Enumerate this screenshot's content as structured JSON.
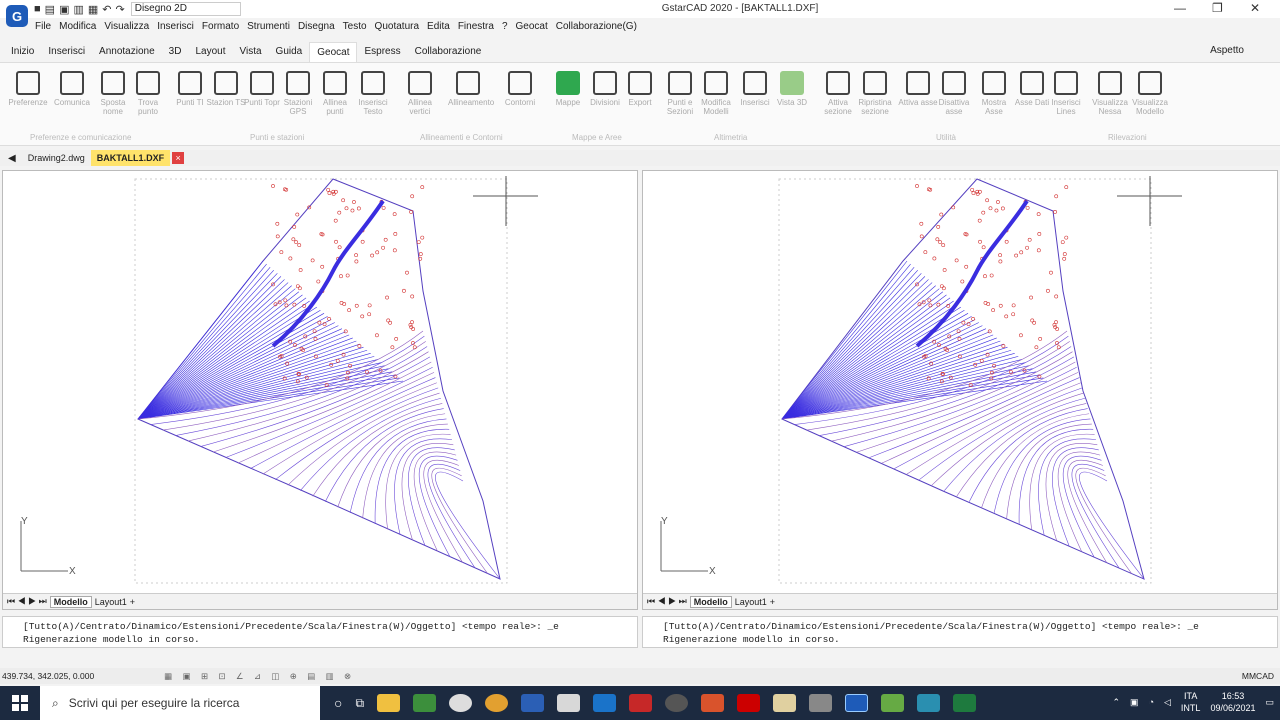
{
  "window": {
    "title": "GstarCAD 2020 - [BAKTALL1.DXF]",
    "workspace": "Disegno 2D",
    "logo": "G"
  },
  "menu": [
    "File",
    "Modifica",
    "Visualizza",
    "Inserisci",
    "Formato",
    "Strumenti",
    "Disegna",
    "Testo",
    "Quotatura",
    "Edita",
    "Finestra",
    "?",
    "Geocat",
    "Collaborazione(G)"
  ],
  "ribbon_tabs": [
    "Inizio",
    "Inserisci",
    "Annotazione",
    "3D",
    "Layout",
    "Vista",
    "Guida",
    "Geocat",
    "Espress",
    "Collaborazione"
  ],
  "active_tab": "Geocat",
  "aspetto": "Aspetto",
  "ribbon_tools": [
    "Preferenze",
    "Comunica",
    "Sposta nome",
    "Trova punto",
    "Punti TI",
    "Stazion TS",
    "Punti Topr",
    "Stazioni GPS",
    "Allinea punti",
    "Inserisci Testo",
    "Allinea vertici",
    "Allineamento",
    "Contorni",
    "Mappe",
    "Divisioni",
    "Export",
    "Punti e Sezioni",
    "Modifica Modelli",
    "Inserisci",
    "Vista 3D",
    "Attiva sezione",
    "Ripristina sezione",
    "Attiva asse",
    "Disattiva asse",
    "Mostra Asse",
    "Asse Dati",
    "Inserisci Lines",
    "Visualizza Nessa",
    "Visualizza Modello"
  ],
  "ribbon_groups": [
    "Preferenze e comunicazione",
    "Punti e stazioni",
    "Allineamenti e Contorni",
    "Mappe e Aree",
    "Altimetria",
    "Utilità",
    "Rilevazioni"
  ],
  "doc_tabs": [
    "Drawing2.dwg",
    "BAKTALL1.DXF"
  ],
  "active_doc": "BAKTALL1.DXF",
  "doc_close": "×",
  "viewport_tabs": {
    "model": "Modello",
    "layout": "Layout1",
    "add": "+",
    "nav": "⏮ ◀ ▶ ⏭"
  },
  "axis": {
    "y": "Y",
    "x": "X"
  },
  "command_line": {
    "line1": "[Tutto(A)/Centrato/Dinamico/Estensioni/Precedente/Scala/Finestra(W)/Oggetto] <tempo reale>: _e",
    "line2": "Rigenerazione modello in corso."
  },
  "status": {
    "coords": "439.734, 342.025, 0.000",
    "units": "MMCAD"
  },
  "taskbar": {
    "search": "Scrivi qui per eseguire la ricerca",
    "lang1": "ITA",
    "lang2": "INTL",
    "time": "16:53",
    "date": "09/06/2021"
  },
  "colors": {
    "contour_blue": "#3a2de0",
    "contour_red": "#d23030",
    "accent": "#1e5bb8",
    "taskbar": "#1c2a40"
  }
}
